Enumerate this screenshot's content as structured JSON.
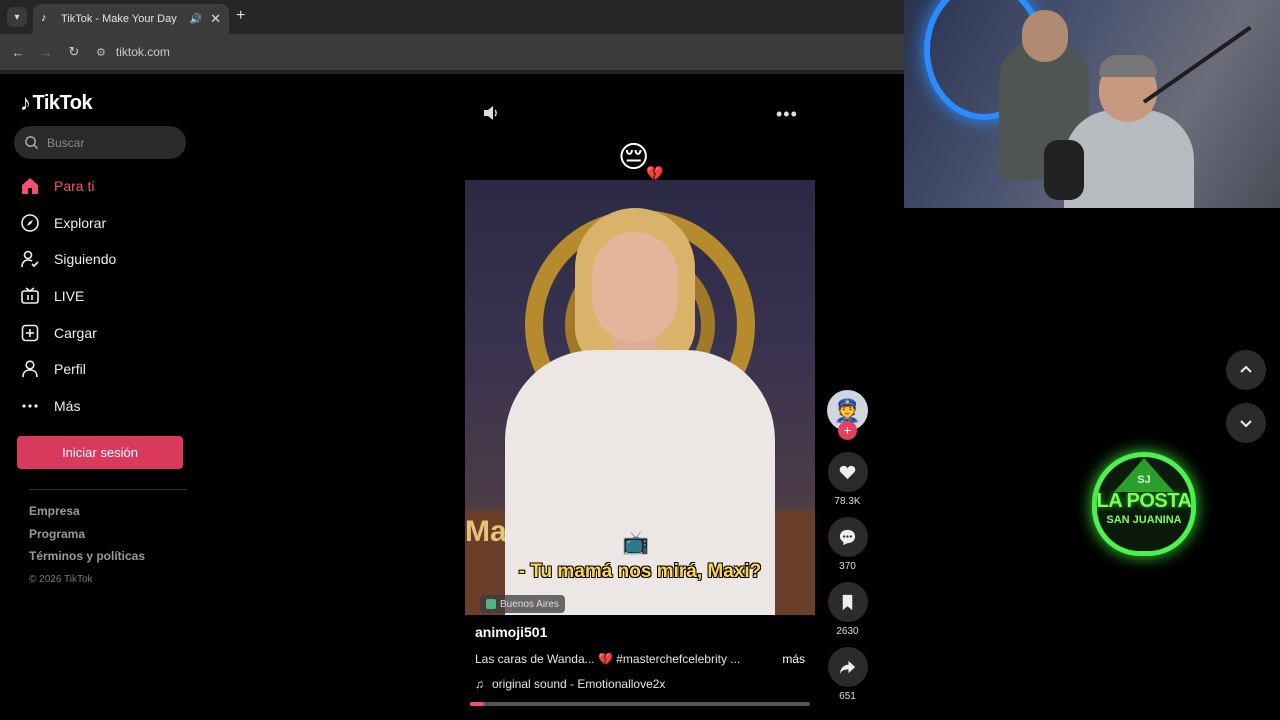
{
  "browser": {
    "tab_title": "TikTok - Make Your Day",
    "url": "tiktok.com",
    "tab_menu_icon": "chevron-down-icon",
    "favicon": "tiktok-icon"
  },
  "tiktok": {
    "logo_text": "TikTok",
    "search_placeholder": "Buscar",
    "nav": [
      {
        "label": "Para ti",
        "icon": "home-icon",
        "active": true
      },
      {
        "label": "Explorar",
        "icon": "compass-icon"
      },
      {
        "label": "Siguiendo",
        "icon": "following-icon"
      },
      {
        "label": "LIVE",
        "icon": "live-tv-icon"
      },
      {
        "label": "Cargar",
        "icon": "upload-icon"
      },
      {
        "label": "Perfil",
        "icon": "profile-icon"
      },
      {
        "label": "Más",
        "icon": "more-icon"
      }
    ],
    "login_label": "Iniciar sesión",
    "footer_links": [
      "Empresa",
      "Programa",
      "Términos y políticas"
    ],
    "copyright": "© 2026 TikTok"
  },
  "video": {
    "caption": "- Tu mamá nos mirá, Maxi?",
    "background_text": "Mas",
    "location": "Buenos Aires",
    "author": "animoji501",
    "description": "Las caras de Wanda... 💔 #masterchefcelebrity ...",
    "more_label": "más",
    "sound": "original sound - Emotionallove2x",
    "progress": 0.04,
    "likes": "78.3K",
    "comments": "370",
    "saves": "2630",
    "shares": "651"
  },
  "stream_overlay": {
    "logo_line1": "SJ",
    "logo_line2": "LA POSTA",
    "logo_line3": "SAN JUANINA"
  },
  "colors": {
    "accent": "#f2506e",
    "login_button": "#d93a5c",
    "caption_yellow": "#ffd84a",
    "logo_green": "#4df24d"
  }
}
